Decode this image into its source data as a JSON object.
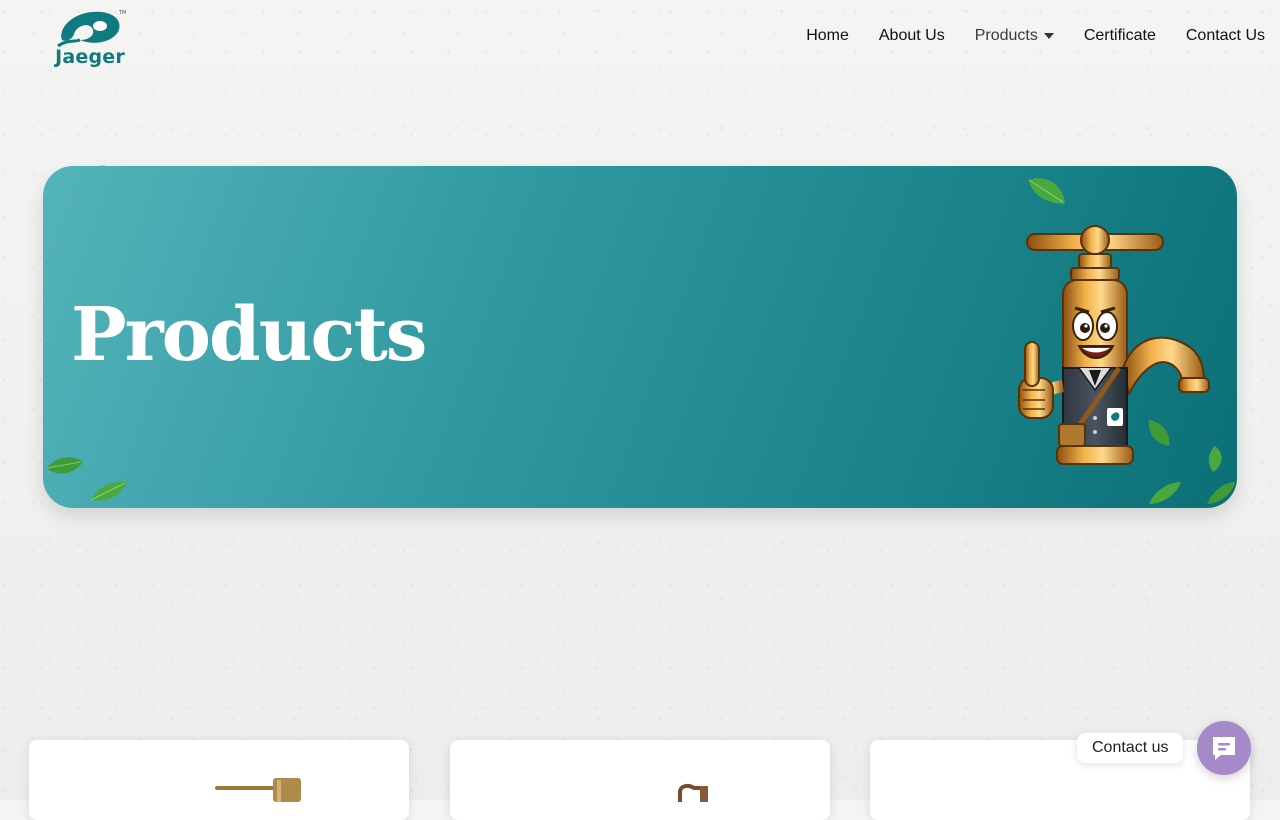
{
  "brand": {
    "name": "Jaeger",
    "trademark": "TM",
    "color": "#0f7a80"
  },
  "nav": {
    "items": [
      {
        "label": "Home"
      },
      {
        "label": "About Us"
      },
      {
        "label": "Products",
        "has_dropdown": true,
        "active": true
      },
      {
        "label": "Certificate"
      },
      {
        "label": "Contact Us"
      }
    ]
  },
  "hero": {
    "title": "Products",
    "gradient": [
      "#54b3bb",
      "#0b6f76"
    ],
    "mascot": "brass-faucet-mascot-thumbs-up"
  },
  "products": [
    {
      "image": "brass-soap-dispenser-pump"
    },
    {
      "image": "bronze-soap-dispenser-pump"
    },
    {
      "image": ""
    }
  ],
  "contact_widget": {
    "label": "Contact us",
    "icon": "chat-bubble-icon",
    "color": "#a689c9"
  }
}
